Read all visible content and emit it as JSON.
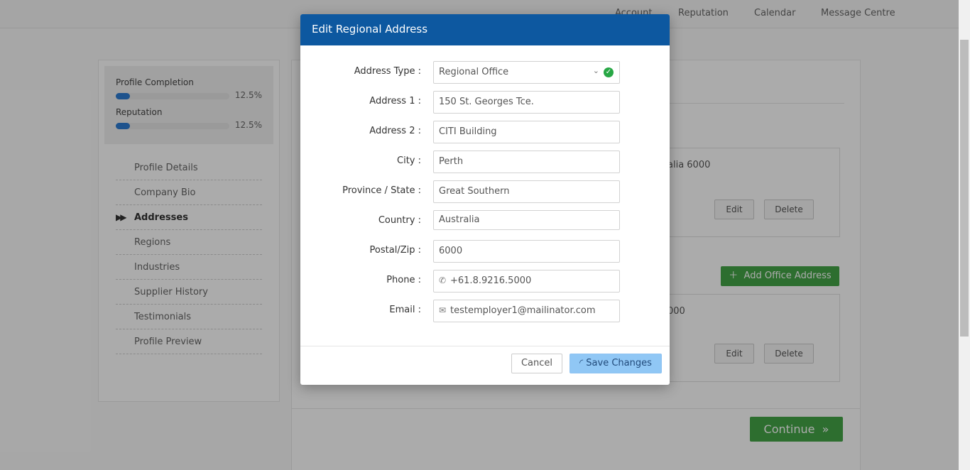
{
  "topnav": {
    "items": [
      "Account",
      "Reputation",
      "Calendar",
      "Message Centre"
    ]
  },
  "sidebar": {
    "profile_completion": {
      "label": "Profile Completion",
      "pct": "12.5%",
      "value": 0.125
    },
    "reputation": {
      "label": "Reputation",
      "pct": "12.5%",
      "value": 0.125
    },
    "items": [
      {
        "label": "Profile Details"
      },
      {
        "label": "Company Bio"
      },
      {
        "label": "Addresses",
        "active": true
      },
      {
        "label": "Regions"
      },
      {
        "label": "Industries"
      },
      {
        "label": "Supplier History"
      },
      {
        "label": "Testimonials"
      },
      {
        "label": "Profile Preview"
      }
    ]
  },
  "main": {
    "card1": {
      "addr": "alia 6000",
      "edit": "Edit",
      "delete": "Delete"
    },
    "add_office_button": "Add Office Address",
    "card2": {
      "addr": "000",
      "edit": "Edit",
      "delete": "Delete"
    },
    "continue_button": "Continue"
  },
  "modal": {
    "title": "Edit Regional Address",
    "fields": [
      {
        "label": "Address Type",
        "value": "Regional Office"
      },
      {
        "label": "Address 1",
        "value": "150 St. Georges Tce."
      },
      {
        "label": "Address 2",
        "value": "CITI Building"
      },
      {
        "label": "City",
        "value": "Perth"
      },
      {
        "label": "Province / State",
        "value": "Great Southern"
      },
      {
        "label": "Country",
        "value": "Australia"
      },
      {
        "label": "Postal/Zip",
        "value": "6000"
      },
      {
        "label": "Phone",
        "value": "+61.8.9216.5000"
      },
      {
        "label": "Email",
        "value": "testemployer1@mailinator.com"
      }
    ],
    "cancel": "Cancel",
    "save": "Save Changes"
  },
  "colors": {
    "header": "#0d58a0",
    "accent_green": "#43a547",
    "save_button": "#90c7f5",
    "progress": "#2d7dd2"
  }
}
